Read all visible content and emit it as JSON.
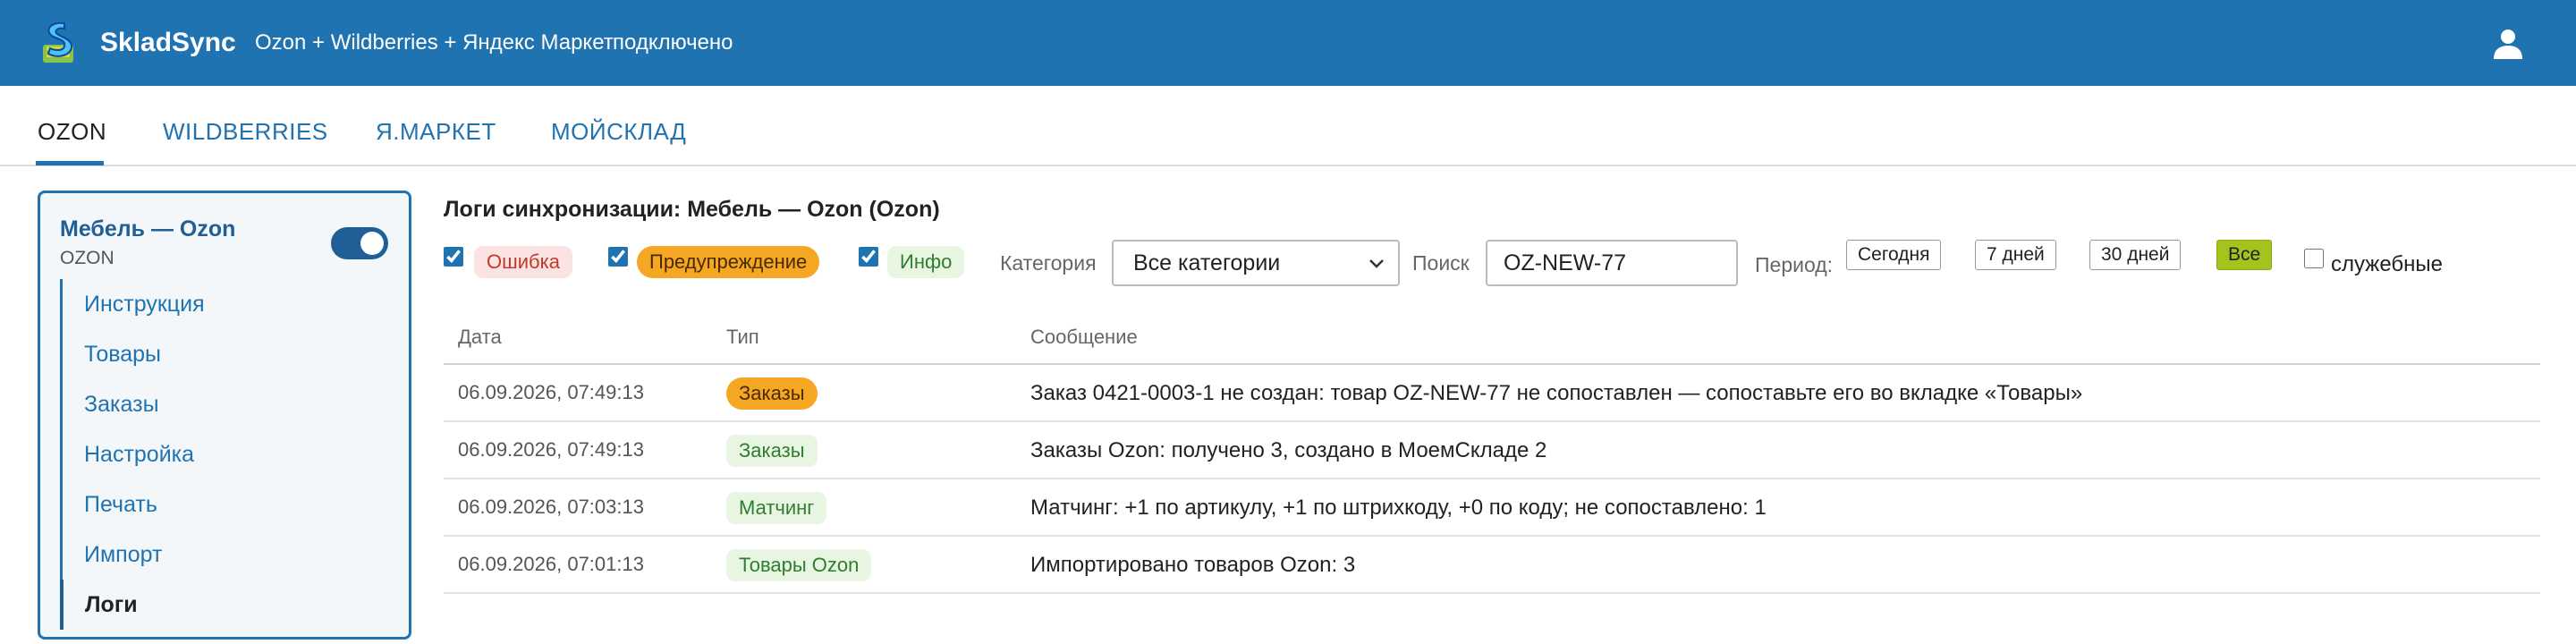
{
  "header": {
    "brand": "SkladSync",
    "subtitle": "Ozon + Wildberries + Яндекс Маркет",
    "status": "подключено"
  },
  "tabs": [
    {
      "label": "OZON",
      "active": true
    },
    {
      "label": "WILDBERRIES",
      "active": false
    },
    {
      "label": "Я.МАРКЕТ",
      "active": false
    },
    {
      "label": "МОЙСКЛАД",
      "active": false
    }
  ],
  "sidebar": {
    "store_name": "Мебель — Ozon",
    "store_sub": "OZON",
    "enabled": true,
    "items": [
      {
        "label": "Инструкция"
      },
      {
        "label": "Товары"
      },
      {
        "label": "Заказы"
      },
      {
        "label": "Настройка"
      },
      {
        "label": "Печать"
      },
      {
        "label": "Импорт"
      },
      {
        "label": "Логи",
        "active": true
      }
    ]
  },
  "main": {
    "title": "Логи синхронизации: Мебель — Ozon (Ozon)",
    "filters": {
      "error_label": "Ошибка",
      "warn_label": "Предупреждение",
      "info_label": "Инфо",
      "category_label": "Категория",
      "category_value": "Все категории",
      "search_label": "Поиск",
      "search_value": "OZ-NEW-77",
      "period_label": "Период:",
      "period_today": "Сегодня",
      "period_7": "7 дней",
      "period_30": "30 дней",
      "period_all": "Все",
      "service_label": "служебные"
    },
    "table": {
      "headers": {
        "date": "Дата",
        "type": "Тип",
        "message": "Сообщение"
      },
      "rows": [
        {
          "date": "06.09.2026, 07:49:13",
          "type": "Заказы",
          "message": "Заказ 0421-0003-1 не создан: товар OZ-NEW-77 не сопоставлен — сопоставьте его во вкладке «Товары»"
        },
        {
          "date": "06.09.2026, 07:49:13",
          "type": "Заказы",
          "message": "Заказы Ozon: получено 3, создано в МоемСкладе 2"
        },
        {
          "date": "06.09.2026, 07:03:13",
          "type": "Матчинг",
          "message": "Матчинг: +1 по артикулу, +1 по штрихкоду, +0 по коду; не сопоставлено: 1"
        },
        {
          "date": "06.09.2026, 07:01:13",
          "type": "Товары Ozon",
          "message": "Импортировано товаров Ozon: 3"
        }
      ]
    }
  },
  "colors": {
    "header": "#1f73b0",
    "accent_warn": "#f5a623",
    "accent_all": "#a3c31d"
  }
}
